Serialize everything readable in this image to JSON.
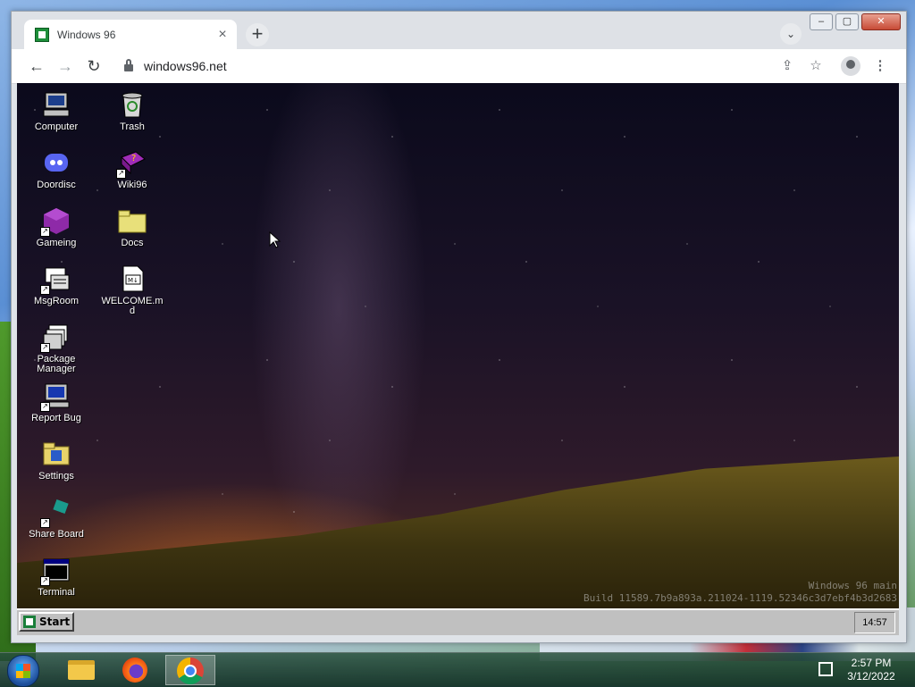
{
  "browser": {
    "tab_title": "Windows 96",
    "url": "windows96.net",
    "icons": {
      "favicon": "windows96-logo-icon",
      "tab_close": "close-icon",
      "new_tab": "plus-icon",
      "tab_search": "chevron-down-icon",
      "back": "arrow-left-icon",
      "forward": "arrow-right-icon",
      "reload": "reload-icon",
      "lock": "lock-icon",
      "share": "share-icon",
      "bookmark": "star-icon",
      "profile": "profile-icon",
      "menu": "kebab-menu-icon"
    }
  },
  "win96": {
    "desktop_icons": [
      {
        "label": "Computer",
        "icon": "computer-icon"
      },
      {
        "label": "Trash",
        "icon": "trash-icon"
      },
      {
        "label": "Doordisc",
        "icon": "discord-icon"
      },
      {
        "label": "Wiki96",
        "icon": "book-icon"
      },
      {
        "label": "Gameing",
        "icon": "cube-icon"
      },
      {
        "label": "Docs",
        "icon": "folder-icon"
      },
      {
        "label": "MsgRoom",
        "icon": "chat-icon"
      },
      {
        "label": "WELCOME.md",
        "icon": "markdown-file-icon"
      },
      {
        "label": "Package Manager",
        "icon": "package-icon"
      },
      {
        "label": "Report Bug",
        "icon": "bug-report-icon"
      },
      {
        "label": "Settings",
        "icon": "settings-icon"
      },
      {
        "label": "Share Board",
        "icon": "share-board-icon"
      },
      {
        "label": "Terminal",
        "icon": "terminal-icon"
      }
    ],
    "build_line1": "Windows 96 main",
    "build_line2": "Build 11589.7b9a893a.211024-1119.52346c3d7ebf4b3d2683",
    "start_label": "Start",
    "clock": "14:57"
  },
  "host": {
    "time": "2:57 PM",
    "date": "3/12/2022",
    "taskbar_items": [
      "windows-start-orb-icon",
      "file-explorer-icon",
      "firefox-icon",
      "chrome-icon"
    ]
  },
  "colors": {
    "w96_taskbar": "#c0c0c0",
    "chrome_frame": "#dee1e6"
  }
}
